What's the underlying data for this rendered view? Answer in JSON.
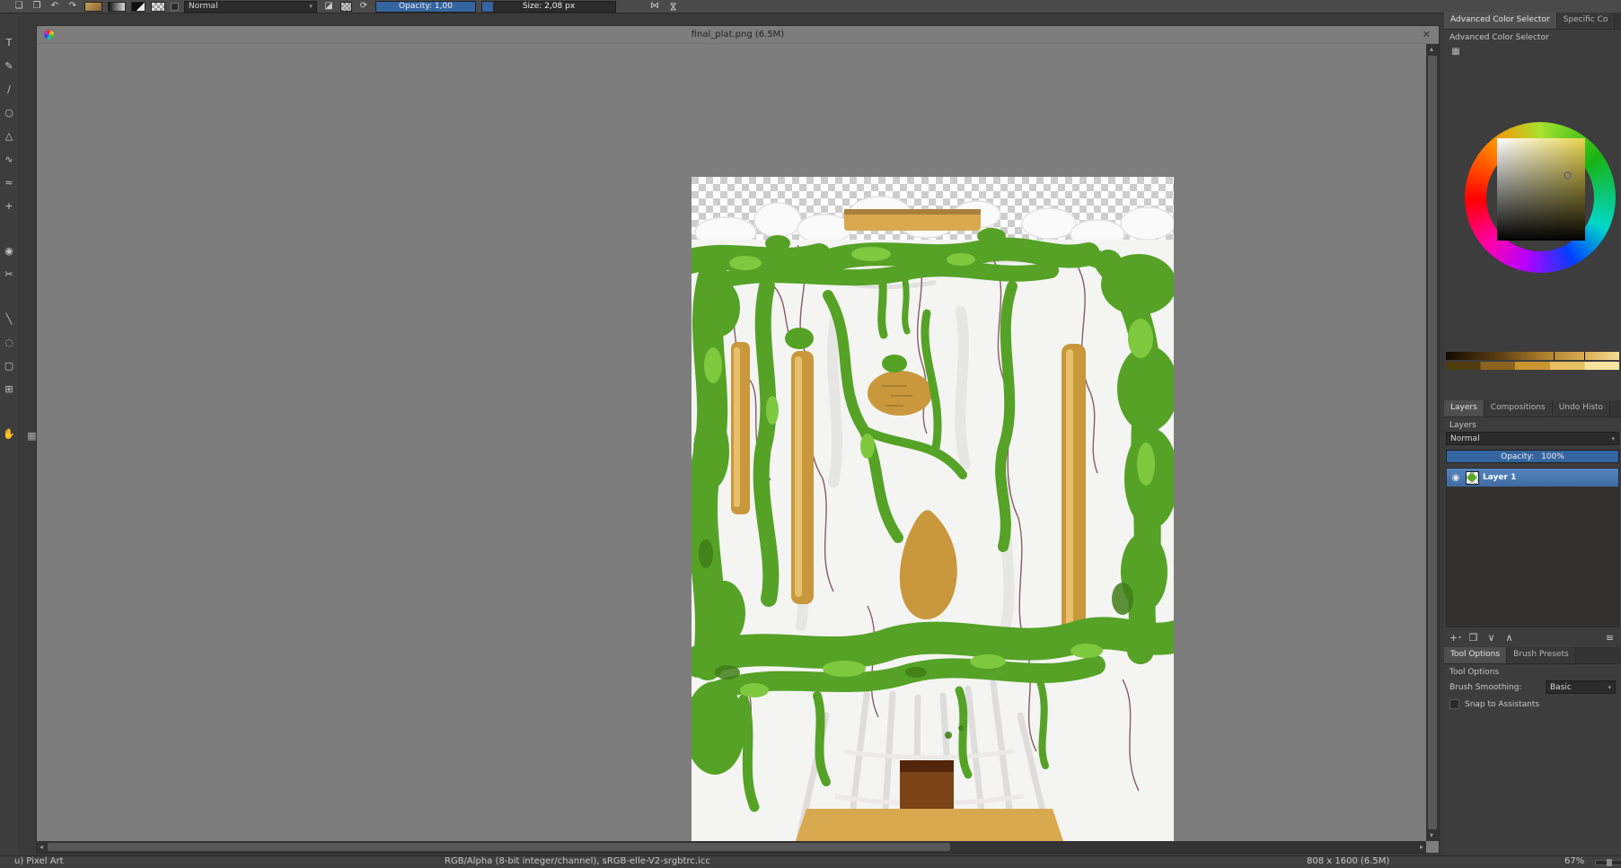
{
  "colors": {
    "accent_blue": "#3565a0",
    "selection_blue": "#4f7fb8",
    "canvas_gray": "#7d7d7d"
  },
  "glyphs": {
    "caret_down": "▾"
  },
  "toolbar": {
    "icons": {
      "new": "❏",
      "open": "❐",
      "undo": "↶",
      "redo": "↷",
      "eraser": "◪",
      "reload": "⟳",
      "mirror_h": "⋈",
      "mirror_v": "⋈"
    },
    "blending_mode": "Normal",
    "opacity_label": "Opacity:",
    "opacity_value": "1,00",
    "size_label": "Size:",
    "size_value": "2,08 px"
  },
  "toolbox": {
    "grip_glyph": "▦",
    "tools": [
      {
        "name": "text-tool",
        "glyph": "T"
      },
      {
        "name": "calligraphy-tool",
        "glyph": "✎"
      },
      {
        "name": "line-tool",
        "glyph": "∕"
      },
      {
        "name": "ellipse-tool",
        "glyph": "○"
      },
      {
        "name": "polygon-tool",
        "glyph": "△"
      },
      {
        "name": "bezier-curve-tool",
        "glyph": "∿"
      },
      {
        "name": "freehand-path-tool",
        "glyph": "≈"
      },
      {
        "name": "move-tool",
        "glyph": "+"
      },
      {
        "name": "color-sampler-tool",
        "glyph": "◉"
      },
      {
        "name": "smart-patch-tool",
        "glyph": "✂"
      },
      {
        "name": "gradient-tool",
        "glyph": "╲"
      },
      {
        "name": "circular-selection-tool",
        "glyph": "◌"
      },
      {
        "name": "contiguous-selection-tool",
        "glyph": "▢"
      },
      {
        "name": "transform-tool",
        "glyph": "⊞"
      },
      {
        "name": "pan-tool",
        "glyph": "✋"
      }
    ]
  },
  "canvas": {
    "title": "final_plat.png (6.5M)",
    "close_glyph": "✕",
    "scroll": {
      "up": "▴",
      "down": "▾",
      "left": "◂",
      "right": "▸"
    }
  },
  "artwork": {
    "colors": {
      "green_base": "#55a226",
      "green_light": "#7fc93e",
      "green_dark": "#3f7d18",
      "gold": "#c9973c",
      "gold_light": "#d8a94e",
      "gold_highlight": "#e6c06a",
      "brown": "#7a4416",
      "brown_dark": "#53260c",
      "crack": "#7c4b56",
      "paper": "#f4f4f3"
    }
  },
  "color_selector": {
    "tabs": [
      "Advanced Color Selector",
      "Specific Co"
    ],
    "section_title": "Advanced Color Selector",
    "settings_glyph": "▦"
  },
  "layers_dock": {
    "tabs": [
      "Layers",
      "Compositions",
      "Undo Histo"
    ],
    "section_title": "Layers",
    "blending_mode": "Normal",
    "opacity_label": "Opacity:",
    "opacity_value": "100%",
    "eye_glyph": "◉",
    "layers": [
      {
        "name": "Layer 1"
      }
    ],
    "buttons": {
      "add": "+",
      "add_caret": "▾",
      "duplicate": "❐",
      "lower": "∨",
      "raise": "∧",
      "properties": "≡"
    }
  },
  "tool_options_dock": {
    "tabs": [
      "Tool Options",
      "Brush Presets"
    ],
    "section_title": "Tool Options",
    "brush_smoothing_label": "Brush Smoothing:",
    "brush_smoothing_value": "Basic",
    "snap_label": "Snap to Assistants"
  },
  "statusbar": {
    "tool_hint": "u) Pixel Art",
    "color_profile": "RGB/Alpha (8-bit integer/channel), sRGB-elle-V2-srgbtrc.icc",
    "image_size": "808 x 1600 (6.5M)",
    "zoom": "67%"
  }
}
